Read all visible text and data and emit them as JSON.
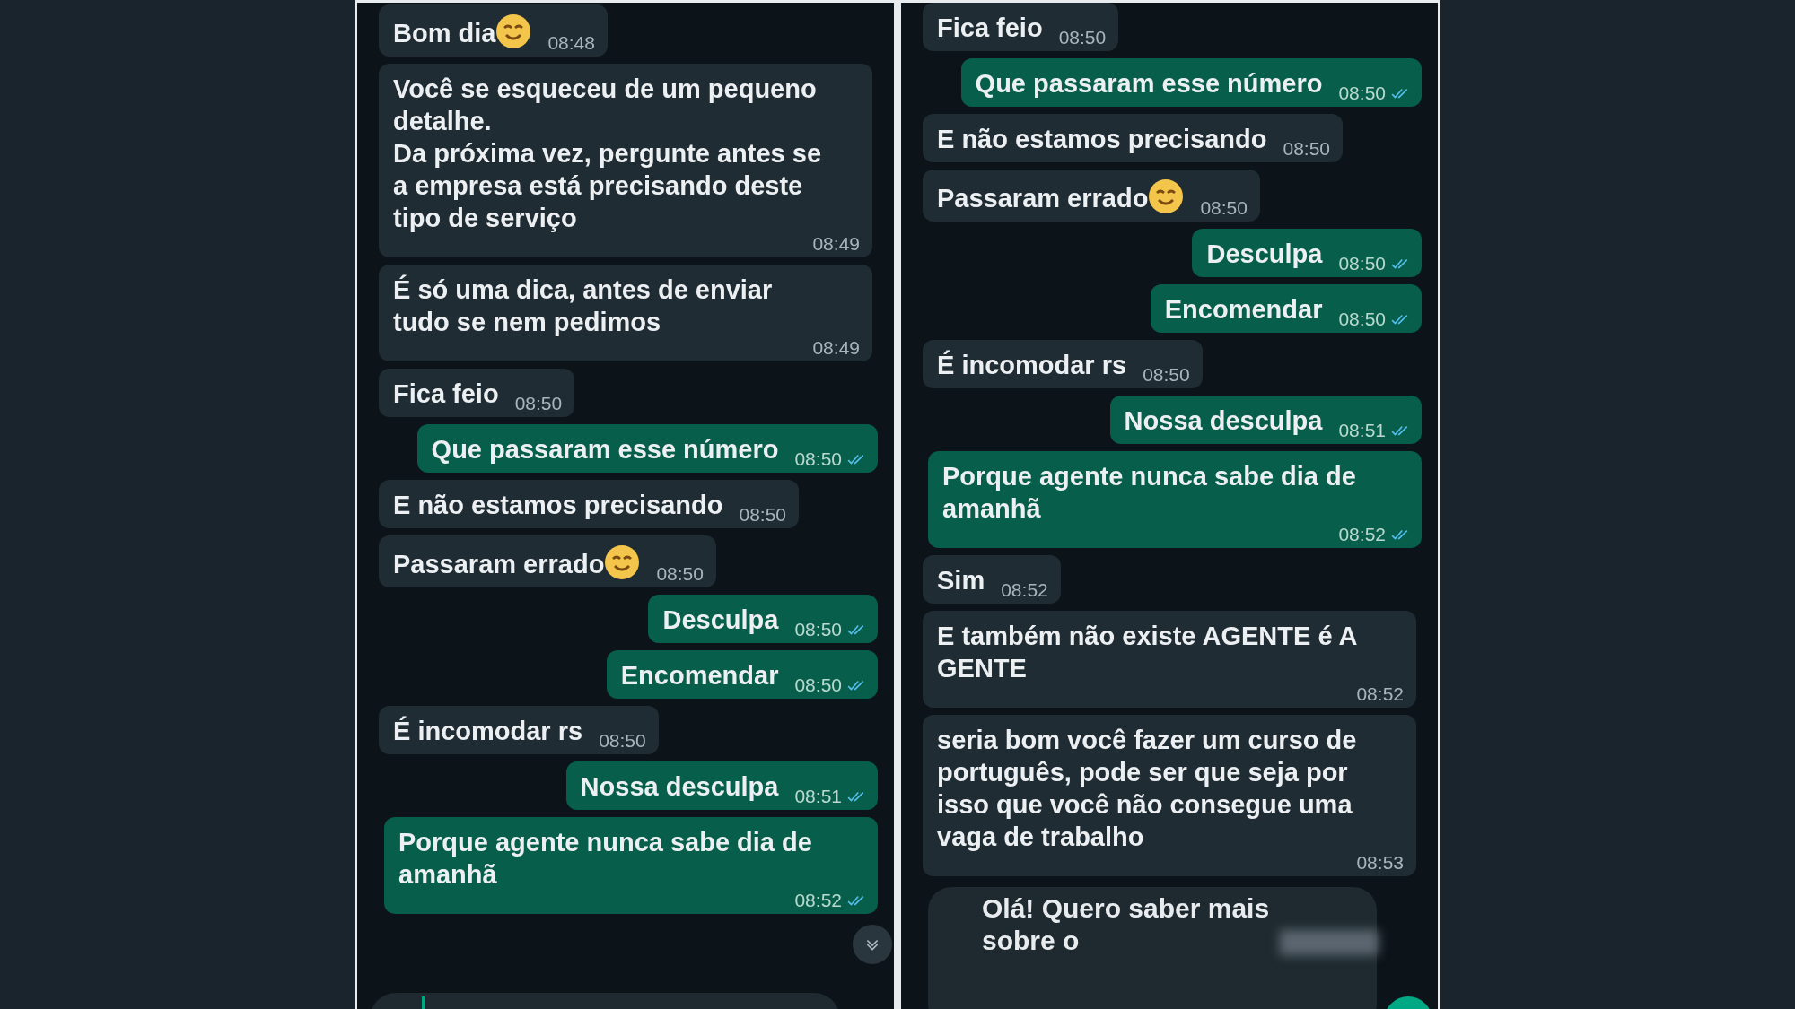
{
  "panels": [
    {
      "messages": [
        {
          "kind": "incoming",
          "text": "Bom dia",
          "emoji": true,
          "time": "08:48"
        },
        {
          "kind": "incoming",
          "text": "Você se esqueceu de um pequeno detalhe.\nDa próxima vez, pergunte antes se a empresa está precisando deste tipo de serviço",
          "time": "08:49"
        },
        {
          "kind": "incoming",
          "text": "É só uma dica, antes de enviar tudo se nem pedimos",
          "time": "08:49"
        },
        {
          "kind": "incoming",
          "text": "Fica feio",
          "time": "08:50"
        },
        {
          "kind": "outgoing",
          "text": "Que passaram esse número",
          "time": "08:50",
          "read": true
        },
        {
          "kind": "incoming",
          "text": "E não estamos precisando",
          "time": "08:50"
        },
        {
          "kind": "incoming",
          "text": "Passaram errado",
          "emoji": true,
          "time": "08:50"
        },
        {
          "kind": "outgoing",
          "text": "Desculpa",
          "time": "08:50",
          "read": true
        },
        {
          "kind": "outgoing",
          "text": "Encomendar",
          "time": "08:50",
          "read": true
        },
        {
          "kind": "incoming",
          "text": "É incomodar rs",
          "time": "08:50"
        },
        {
          "kind": "outgoing",
          "text": "Nossa desculpa",
          "time": "08:51",
          "read": true
        },
        {
          "kind": "outgoing",
          "text": "Porque agente nunca sabe dia de amanhã",
          "time": "08:52",
          "read": true
        }
      ],
      "scroll_button": true,
      "composer": true,
      "fab": false
    },
    {
      "messages": [
        {
          "kind": "incoming",
          "text": "Fica feio",
          "time": "08:50"
        },
        {
          "kind": "outgoing",
          "text": "Que passaram esse número",
          "time": "08:50",
          "read": true
        },
        {
          "kind": "incoming",
          "text": "E não estamos precisando",
          "time": "08:50"
        },
        {
          "kind": "incoming",
          "text": "Passaram errado",
          "emoji": true,
          "time": "08:50"
        },
        {
          "kind": "outgoing",
          "text": "Desculpa",
          "time": "08:50",
          "read": true
        },
        {
          "kind": "outgoing",
          "text": "Encomendar",
          "time": "08:50",
          "read": true
        },
        {
          "kind": "incoming",
          "text": "É incomodar rs",
          "time": "08:50"
        },
        {
          "kind": "outgoing",
          "text": "Nossa desculpa",
          "time": "08:51",
          "read": true
        },
        {
          "kind": "outgoing",
          "text": "Porque agente nunca sabe dia de amanhã",
          "time": "08:52",
          "read": true
        },
        {
          "kind": "incoming",
          "text": "Sim",
          "time": "08:52"
        },
        {
          "kind": "incoming",
          "text": "E também não existe AGENTE é A GENTE",
          "time": "08:52"
        },
        {
          "kind": "incoming",
          "text": "seria bom você fazer um curso de português, pode ser que seja por isso que você não consegue uma vaga de trabalho",
          "time": "08:53"
        },
        {
          "kind": "draft",
          "text": "Olá! Quero saber mais sobre o"
        }
      ],
      "scroll_button": false,
      "composer": false,
      "fab": true
    }
  ]
}
